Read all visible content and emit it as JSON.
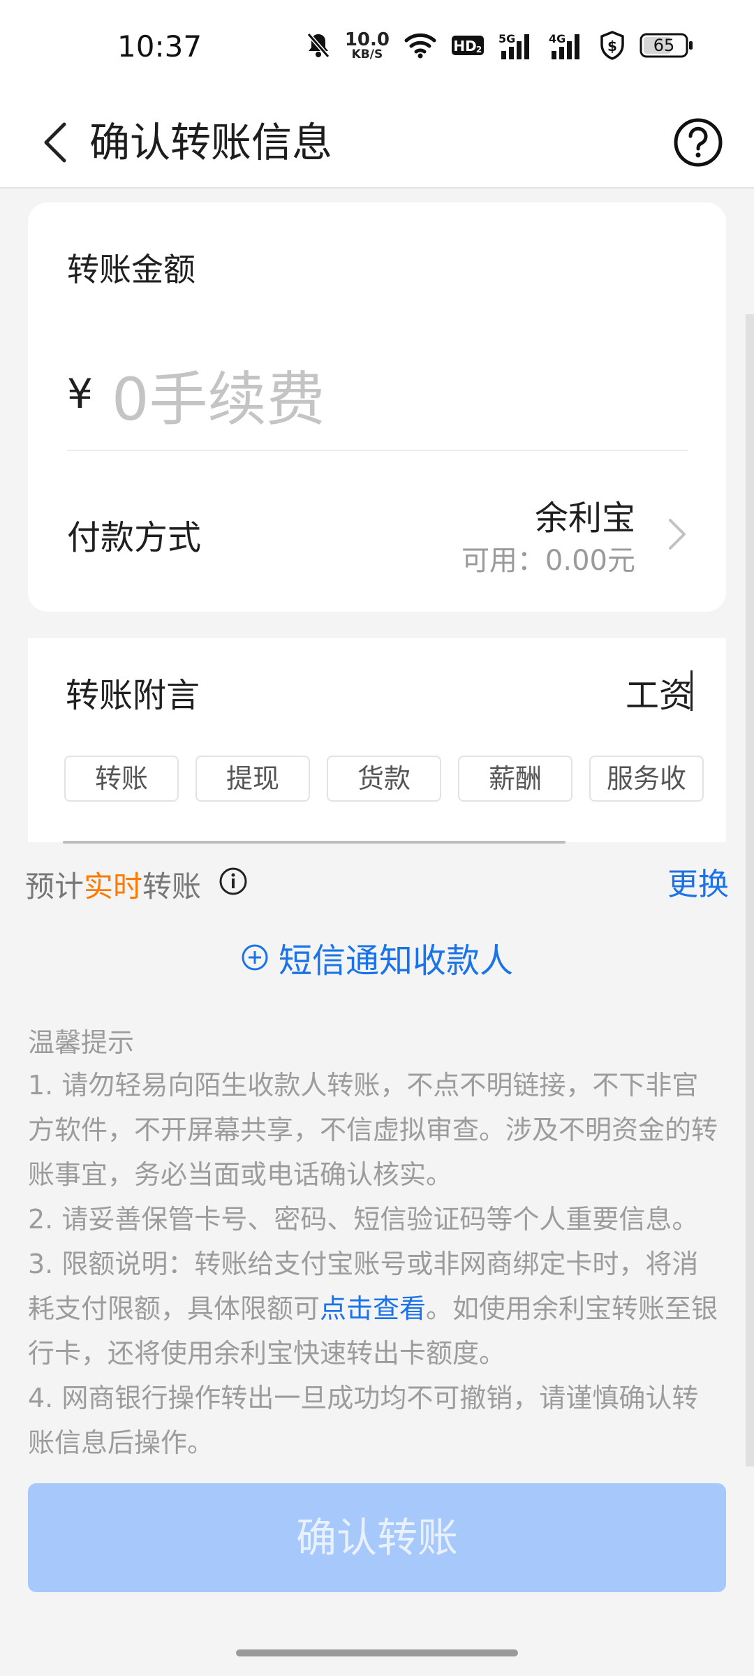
{
  "status_bar": {
    "time": "10:37",
    "net_speed_value": "10.0",
    "net_speed_unit": "KB/S",
    "battery": "65",
    "icons": [
      "mute-bell-icon",
      "wifi-icon",
      "hd-icon",
      "signal-5g-icon",
      "signal-4g-icon",
      "shield-dollar-icon",
      "battery-icon"
    ]
  },
  "header": {
    "title": "确认转账信息",
    "back_icon": "chevron-left-icon",
    "help_icon": "question-circle-icon"
  },
  "amount": {
    "label": "转账金额",
    "currency": "¥",
    "placeholder": "0手续费"
  },
  "payment": {
    "label": "付款方式",
    "method": "余利宝",
    "available": "可用：0.00元"
  },
  "memo": {
    "label": "转账附言",
    "value": "工资",
    "chips": [
      "转账",
      "提现",
      "货款",
      "薪酬",
      "服务收"
    ]
  },
  "eta": {
    "prefix": "预计",
    "highlight": "实时",
    "suffix": "转账",
    "change": "更换"
  },
  "sms": {
    "label": "短信通知收款人"
  },
  "tips": {
    "title": "温馨提示",
    "item1": "1. 请勿轻易向陌生收款人转账，不点不明链接，不下非官方软件，不开屏幕共享，不信虚拟审查。涉及不明资金的转账事宜，务必当面或电话确认核实。",
    "item2": "2. 请妥善保管卡号、密码、短信验证码等个人重要信息。",
    "item3_before": "3. 限额说明：转账给支付宝账号或非网商绑定卡时，将消耗支付限额，具体限额可",
    "item3_link": "点击查看",
    "item3_after": "。如使用余利宝转账至银行卡，还将使用余利宝快速转出卡额度。",
    "item4": "4. 网商银行操作转出一旦成功均不可撤销，请谨慎确认转账信息后操作。"
  },
  "confirm_button": "确认转账",
  "colors": {
    "accent": "#1a73e8",
    "highlight": "#ff7a00",
    "button_disabled": "#a6c8fb"
  }
}
